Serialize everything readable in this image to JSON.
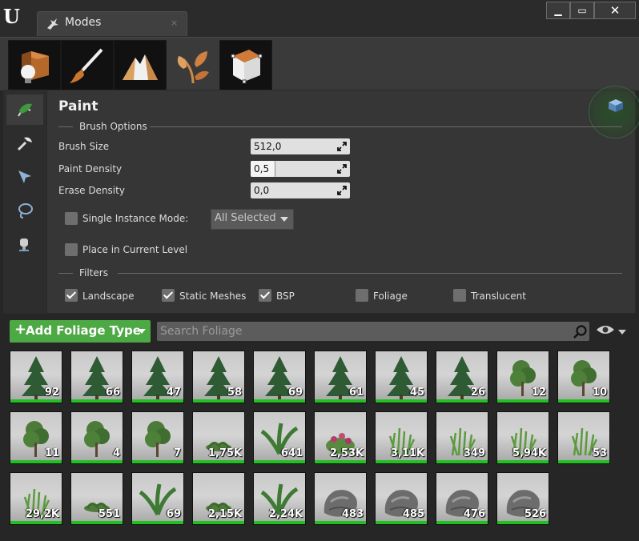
{
  "window": {
    "tab_title": "Modes",
    "tab_close": "×",
    "minimize": "▁",
    "maximize": "▭",
    "close": "✕"
  },
  "modes": [
    {
      "name": "place",
      "icon": "place-mode-icon"
    },
    {
      "name": "paint",
      "icon": "paint-mode-icon"
    },
    {
      "name": "landscape",
      "icon": "landscape-mode-icon"
    },
    {
      "name": "foliage",
      "icon": "foliage-mode-icon",
      "active": true
    },
    {
      "name": "geometry",
      "icon": "geometry-mode-icon"
    }
  ],
  "tools": [
    "paint-tool-icon",
    "reapply-tool-icon",
    "select-tool-icon",
    "lasso-tool-icon",
    "fill-tool-icon"
  ],
  "panel": {
    "title": "Paint",
    "brush_options": "Brush Options",
    "brush_size_label": "Brush Size",
    "brush_size_value": "512,0",
    "paint_density_label": "Paint Density",
    "paint_density_value": "0,5",
    "paint_density_fraction": 0.5,
    "erase_density_label": "Erase Density",
    "erase_density_value": "0,0",
    "single_instance_label": "Single Instance Mode:",
    "single_instance_checked": false,
    "combo_value": "All Selected",
    "place_current_label": "Place in Current Level",
    "place_current_checked": false,
    "filters": "Filters",
    "filter_landscape": "Landscape",
    "filter_static_meshes": "Static Meshes",
    "filter_bsp": "BSP",
    "filter_foliage": "Foliage",
    "filter_translucent": "Translucent"
  },
  "toolbar": {
    "add_label": "Add Foliage Type",
    "search_placeholder": "Search Foliage"
  },
  "foliage": [
    {
      "kind": "conifer",
      "count": "92"
    },
    {
      "kind": "conifer",
      "count": "66"
    },
    {
      "kind": "conifer",
      "count": "47"
    },
    {
      "kind": "conifer",
      "count": "58"
    },
    {
      "kind": "conifer",
      "count": "69"
    },
    {
      "kind": "conifer",
      "count": "61"
    },
    {
      "kind": "conifer",
      "count": "45"
    },
    {
      "kind": "conifer",
      "count": "26"
    },
    {
      "kind": "leafy",
      "count": "12"
    },
    {
      "kind": "leafy",
      "count": "10"
    },
    {
      "kind": "leafy",
      "count": "11"
    },
    {
      "kind": "leafy",
      "count": "4"
    },
    {
      "kind": "leafy",
      "count": "7"
    },
    {
      "kind": "shrub",
      "count": "1,75K"
    },
    {
      "kind": "fern",
      "count": "641"
    },
    {
      "kind": "flowers",
      "count": "2,53K"
    },
    {
      "kind": "grass",
      "count": "3,11K"
    },
    {
      "kind": "grass",
      "count": "349"
    },
    {
      "kind": "grass",
      "count": "5,94K"
    },
    {
      "kind": "grass",
      "count": "53"
    },
    {
      "kind": "grass",
      "count": "29,2K"
    },
    {
      "kind": "shrub",
      "count": "551"
    },
    {
      "kind": "fern",
      "count": "69"
    },
    {
      "kind": "shrub",
      "count": "2,15K"
    },
    {
      "kind": "fern",
      "count": "2,24K"
    },
    {
      "kind": "rock",
      "count": "483"
    },
    {
      "kind": "rock",
      "count": "485"
    },
    {
      "kind": "rock",
      "count": "476"
    },
    {
      "kind": "rock",
      "count": "526"
    }
  ],
  "colors": {
    "accent_green": "#4da944",
    "tile_bar": "#23c023"
  }
}
